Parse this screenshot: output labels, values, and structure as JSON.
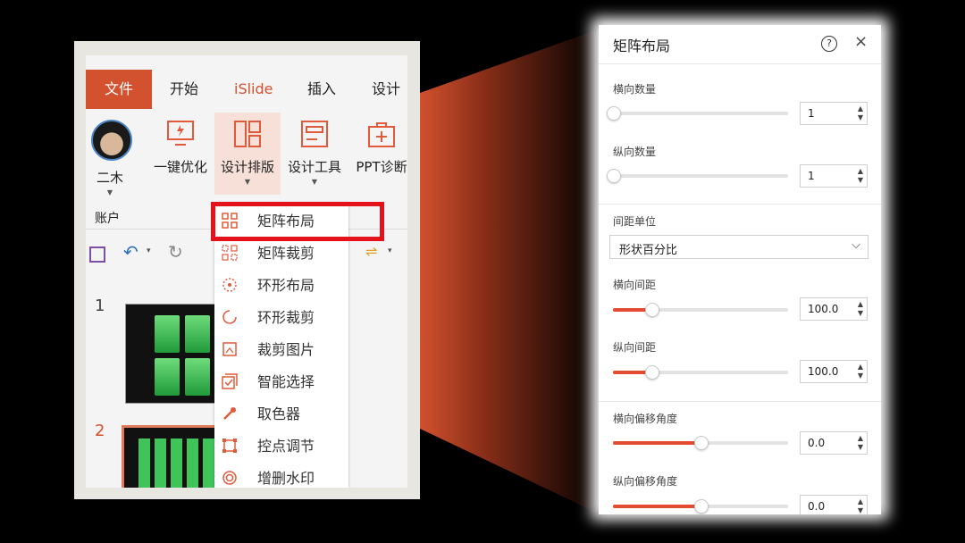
{
  "ribbon": {
    "tabs": [
      "文件",
      "开始",
      "iSlide",
      "插入",
      "设计"
    ],
    "account_label": "账户",
    "buttons": [
      "二木",
      "一键优化",
      "设计排版",
      "设计工具",
      "PPT诊断"
    ]
  },
  "dropdown_menu": {
    "items": [
      "矩阵布局",
      "矩阵裁剪",
      "环形布局",
      "环形裁剪",
      "裁剪图片",
      "智能选择",
      "取色器",
      "控点调节",
      "增删水印"
    ]
  },
  "slides": {
    "numbers": [
      "1",
      "2"
    ]
  },
  "panel": {
    "title": "矩阵布局",
    "help_glyph": "?",
    "close_glyph": "×",
    "fields": [
      {
        "label": "横向数量",
        "value": "1",
        "level": 0.0
      },
      {
        "label": "纵向数量",
        "value": "1",
        "level": 0.0
      },
      {
        "label": "横向间距",
        "value": "100.0",
        "level": 0.22
      },
      {
        "label": "纵向间距",
        "value": "100.0",
        "level": 0.22
      },
      {
        "label": "横向偏移角度",
        "value": "0.0",
        "level": 0.5
      },
      {
        "label": "纵向偏移角度",
        "value": "0.0",
        "level": 0.5
      }
    ],
    "spacing_unit": {
      "label": "间距单位",
      "selected": "形状百分比"
    }
  },
  "colors": {
    "accent": "#d2512e",
    "highlight_box": "#e6121b",
    "slider_fill": "#e44a30"
  }
}
